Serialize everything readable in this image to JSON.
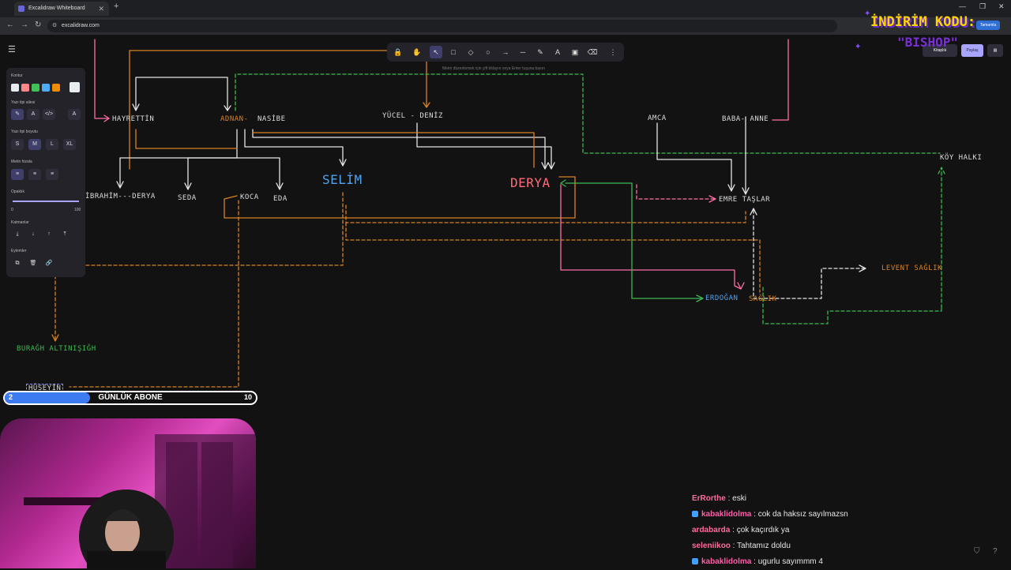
{
  "browser": {
    "tab_title": "Excalidraw Whiteboard",
    "url": "excalidraw.com",
    "tab_close": "✕",
    "new_tab": "+",
    "window_controls": [
      "—",
      "❐",
      "✕"
    ]
  },
  "toolbar": {
    "hint_text": "Metni düzenlemek için çift tıklayın veya Enter tuşuna basın",
    "tools": [
      "🔒",
      "✋",
      "↖",
      "□",
      "◇",
      "○",
      "→",
      "─",
      "✎",
      "A",
      "▣",
      "⌫",
      "⋮"
    ]
  },
  "properties_panel": {
    "stroke_label": "Kontur",
    "font_family_label": "Yazı tipi ailesi",
    "font_size_label": "Yazı tipi boyutu",
    "font_sizes": [
      "S",
      "M",
      "L",
      "XL"
    ],
    "text_align_label": "Metin hizala",
    "opacity_label": "Opaklık",
    "opacity_min": "0",
    "opacity_max": "100",
    "layers_label": "Katmanlar",
    "actions_label": "Eylemler",
    "stroke_colors": [
      "#e9ecef",
      "#ff8787",
      "#40c057",
      "#4dabf7",
      "#f08c00"
    ],
    "font_family_icons": [
      "✎",
      "A",
      "</>",
      "A"
    ],
    "align_icons": [
      "≡",
      "≡",
      "≡"
    ],
    "layer_icons": [
      "⤓",
      "↓",
      "↑",
      "⤒"
    ],
    "action_icons": [
      "⧉",
      "🗑",
      "🔗"
    ]
  },
  "top_right": {
    "share_label": "Paylaş",
    "library_label": "Kitaplık",
    "ext_label": "Tamamla",
    "promo_line1": "İNDİRİM KODU:",
    "promo_line2": "\"BISHOP\""
  },
  "canvas_labels": {
    "hayrettin": "HAYRETTİN",
    "adnan": "ADNAN-",
    "nasibe": "NASİBE",
    "yucel_deniz": "YÜCEL - DENİZ",
    "amca": "AMCA",
    "baba_anne": "BABA- ANNE",
    "koy_halki": "KÖY HALKI",
    "ibrahim_derya": "İBRAHİM---DERYA",
    "seda": "SEDA",
    "koca": "KOCA",
    "eda": "EDA",
    "selim": "SELİM",
    "derya": "DERYA",
    "emre_taslar": "EMRE TAŞLAR",
    "levent_saglik": "LEVENT SAĞLIK",
    "erdogan": "ERDOĞAN",
    "saglik": "SAĞLIK",
    "buragh": "BURAĞH ALTINIŞIĞH",
    "huseyin": "HÜSEYİN"
  },
  "progress": {
    "title": "GÜNLÜK ABONE",
    "current": "2",
    "goal": "10",
    "fraction": 0.2
  },
  "chat": [
    {
      "user": "ErRorthe",
      "color": "#ff6b9a",
      "text": " : eski",
      "badge": false
    },
    {
      "user": "kabaklidolma",
      "color": "#ff5fa8",
      "text": " : cok da haksız sayılmazsn",
      "badge": true
    },
    {
      "user": "ardabarda",
      "color": "#ff6b9a",
      "text": " : çok kaçırdık ya",
      "badge": false
    },
    {
      "user": "seleniikoo",
      "color": "#ff6b9a",
      "text": " : Tahtamız doldu",
      "badge": false
    },
    {
      "user": "kabaklidolma",
      "color": "#ff5fa8",
      "text": " : ugurlu sayımmm 4",
      "badge": true
    }
  ],
  "colors": {
    "orange": "#d98324",
    "white": "#e6e6e6",
    "green": "#3fb950",
    "pink": "#ff6fa8",
    "blue": "#4ea3f0",
    "derya_red": "#ff6b7a"
  }
}
